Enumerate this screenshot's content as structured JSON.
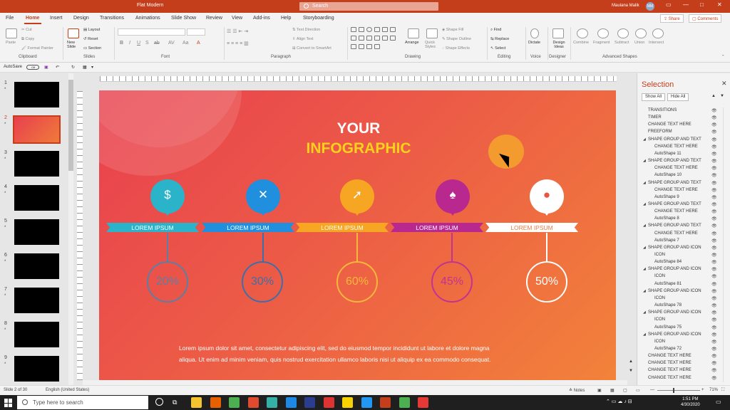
{
  "window": {
    "title": "Flat Modern",
    "search_placeholder": "Search",
    "user_name": "Maulana Malik",
    "user_initials": "MM"
  },
  "menu": {
    "items": [
      "File",
      "Home",
      "Insert",
      "Design",
      "Transitions",
      "Animations",
      "Slide Show",
      "Review",
      "View",
      "Add-ins",
      "Help",
      "Storyboarding"
    ],
    "share": "Share",
    "comments": "Comments"
  },
  "ribbon": {
    "groups": [
      "Clipboard",
      "Slides",
      "Font",
      "Paragraph",
      "Drawing",
      "Editing",
      "Voice",
      "Designer",
      "Advanced Shapes"
    ],
    "clipboard": {
      "paste": "Paste",
      "cut": "Cut",
      "copy": "Copy",
      "format_painter": "Format Painter"
    },
    "slides": {
      "new_slide": "New Slide",
      "layout": "Layout",
      "reset": "Reset",
      "section": "Section"
    },
    "paragraph": {
      "text_direction": "Text Direction",
      "align_text": "Align Text",
      "smartart": "Convert to SmartArt"
    },
    "drawing": {
      "arrange": "Arrange",
      "quick_styles": "Quick Styles",
      "shape_fill": "Shape Fill",
      "shape_outline": "Shape Outline",
      "shape_effects": "Shape Effects"
    },
    "editing": {
      "find": "Find",
      "replace": "Replace",
      "select": "Select"
    },
    "voice": {
      "dictate": "Dictate"
    },
    "designer": {
      "design_ideas": "Design Ideas"
    },
    "advanced": {
      "combine": "Combine",
      "fragment": "Fragment",
      "subtract": "Subtract",
      "union": "Union",
      "intersect": "Intersect"
    }
  },
  "qat": {
    "autosave": "AutoSave",
    "toggle": "Off"
  },
  "thumbnails": {
    "numbers": [
      "1",
      "2",
      "3",
      "4",
      "5",
      "6",
      "7",
      "8",
      "9"
    ],
    "star": "*"
  },
  "slide": {
    "title_line1": "YOUR",
    "title_line2": "INFOGRAPHIC",
    "items": [
      {
        "label": "LOREM IPSUM",
        "value": "20%",
        "icon": "money-bag-icon",
        "glyph": "$",
        "color": "#2bb3c9",
        "value_color": "#5e7fa3"
      },
      {
        "label": "LOREM IPSUM",
        "value": "30%",
        "icon": "tools-icon",
        "glyph": "✕",
        "color": "#1f8fde",
        "value_color": "#3d6fa8"
      },
      {
        "label": "LOREM IPSUM",
        "value": "60%",
        "icon": "cursor-click-icon",
        "glyph": "➚",
        "color": "#f6a623",
        "value_color": "#f6b73c"
      },
      {
        "label": "LOREM IPSUM",
        "value": "45%",
        "icon": "bell-icon",
        "glyph": "♠",
        "color": "#b8288f",
        "value_color": "#c2338f"
      },
      {
        "label": "LOREM IPSUM",
        "value": "50%",
        "icon": "globe-icon",
        "glyph": "●",
        "color": "#ffffff",
        "value_color": "#ffffff"
      }
    ],
    "body_line1": "Lorem ipsum dolor sit amet, consectetur adipiscing elit, sed do eiusmod tempor incididunt ut labore et dolore magna",
    "body_line2": "aliqua. Ut enim ad minim veniam, quis nostrud exercitation ullamco laboris nisi ut aliquip ex ea commodo consequat."
  },
  "selection_pane": {
    "title": "Selection",
    "show_all": "Show All",
    "hide_all": "Hide All",
    "rows": [
      {
        "label": "TRANSITIONS",
        "indent": 0,
        "group": false
      },
      {
        "label": "TIMER",
        "indent": 0,
        "group": false
      },
      {
        "label": "CHANGE TEXT HERE",
        "indent": 0,
        "group": false
      },
      {
        "label": "FREEFORM",
        "indent": 0,
        "group": false
      },
      {
        "label": "SHAPE GROUP AND TEXT",
        "indent": 0,
        "group": true
      },
      {
        "label": "CHANGE TEXT HERE",
        "indent": 1,
        "group": false
      },
      {
        "label": "AutoShape 11",
        "indent": 1,
        "group": false
      },
      {
        "label": "SHAPE GROUP AND TEXT",
        "indent": 0,
        "group": true
      },
      {
        "label": "CHANGE TEXT HERE",
        "indent": 1,
        "group": false
      },
      {
        "label": "AutoShape 10",
        "indent": 1,
        "group": false
      },
      {
        "label": "SHAPE GROUP AND TEXT",
        "indent": 0,
        "group": true
      },
      {
        "label": "CHANGE TEXT HERE",
        "indent": 1,
        "group": false
      },
      {
        "label": "AutoShape 9",
        "indent": 1,
        "group": false
      },
      {
        "label": "SHAPE GROUP AND TEXT",
        "indent": 0,
        "group": true
      },
      {
        "label": "CHANGE TEXT HERE",
        "indent": 1,
        "group": false
      },
      {
        "label": "AutoShape 8",
        "indent": 1,
        "group": false
      },
      {
        "label": "SHAPE GROUP AND TEXT",
        "indent": 0,
        "group": true
      },
      {
        "label": "CHANGE TEXT HERE",
        "indent": 1,
        "group": false
      },
      {
        "label": "AutoShape 7",
        "indent": 1,
        "group": false
      },
      {
        "label": "SHAPE GROUP AND ICON",
        "indent": 0,
        "group": true
      },
      {
        "label": "ICON",
        "indent": 1,
        "group": false
      },
      {
        "label": "AutoShape 84",
        "indent": 1,
        "group": false
      },
      {
        "label": "SHAPE GROUP AND ICON",
        "indent": 0,
        "group": true
      },
      {
        "label": "ICON",
        "indent": 1,
        "group": false
      },
      {
        "label": "AutoShape 81",
        "indent": 1,
        "group": false
      },
      {
        "label": "SHAPE GROUP AND ICON",
        "indent": 0,
        "group": true
      },
      {
        "label": "ICON",
        "indent": 1,
        "group": false
      },
      {
        "label": "AutoShape 78",
        "indent": 1,
        "group": false
      },
      {
        "label": "SHAPE GROUP AND ICON",
        "indent": 0,
        "group": true
      },
      {
        "label": "ICON",
        "indent": 1,
        "group": false
      },
      {
        "label": "AutoShape 75",
        "indent": 1,
        "group": false
      },
      {
        "label": "SHAPE GROUP AND ICON",
        "indent": 0,
        "group": true
      },
      {
        "label": "ICON",
        "indent": 1,
        "group": false
      },
      {
        "label": "AutoShape 72",
        "indent": 1,
        "group": false
      },
      {
        "label": "CHANGE TEXT HERE",
        "indent": 0,
        "group": false
      },
      {
        "label": "CHANGE TEXT HERE",
        "indent": 0,
        "group": false
      },
      {
        "label": "CHANGE TEXT HERE",
        "indent": 0,
        "group": false
      },
      {
        "label": "CHANGE TEXT HERE",
        "indent": 0,
        "group": false
      }
    ]
  },
  "status": {
    "slide": "Slide 2 of 30",
    "language": "English (United States)",
    "notes": "Notes",
    "zoom": "71%"
  },
  "taskbar": {
    "search_placeholder": "Type here to search",
    "time": "1:51 PM",
    "date": "4/30/2020",
    "apps": [
      {
        "color": "#f4c430"
      },
      {
        "color": "#e66000"
      },
      {
        "color": "#4caf50"
      },
      {
        "color": "#e04a2f"
      },
      {
        "color": "#35b0a6"
      },
      {
        "color": "#1e88e5"
      },
      {
        "color": "#2a3d8f"
      },
      {
        "color": "#d33"
      },
      {
        "color": "#f7d200"
      },
      {
        "color": "#2196f3"
      },
      {
        "color": "#c43e1c"
      },
      {
        "color": "#4caf50"
      },
      {
        "color": "#e53935"
      }
    ]
  }
}
